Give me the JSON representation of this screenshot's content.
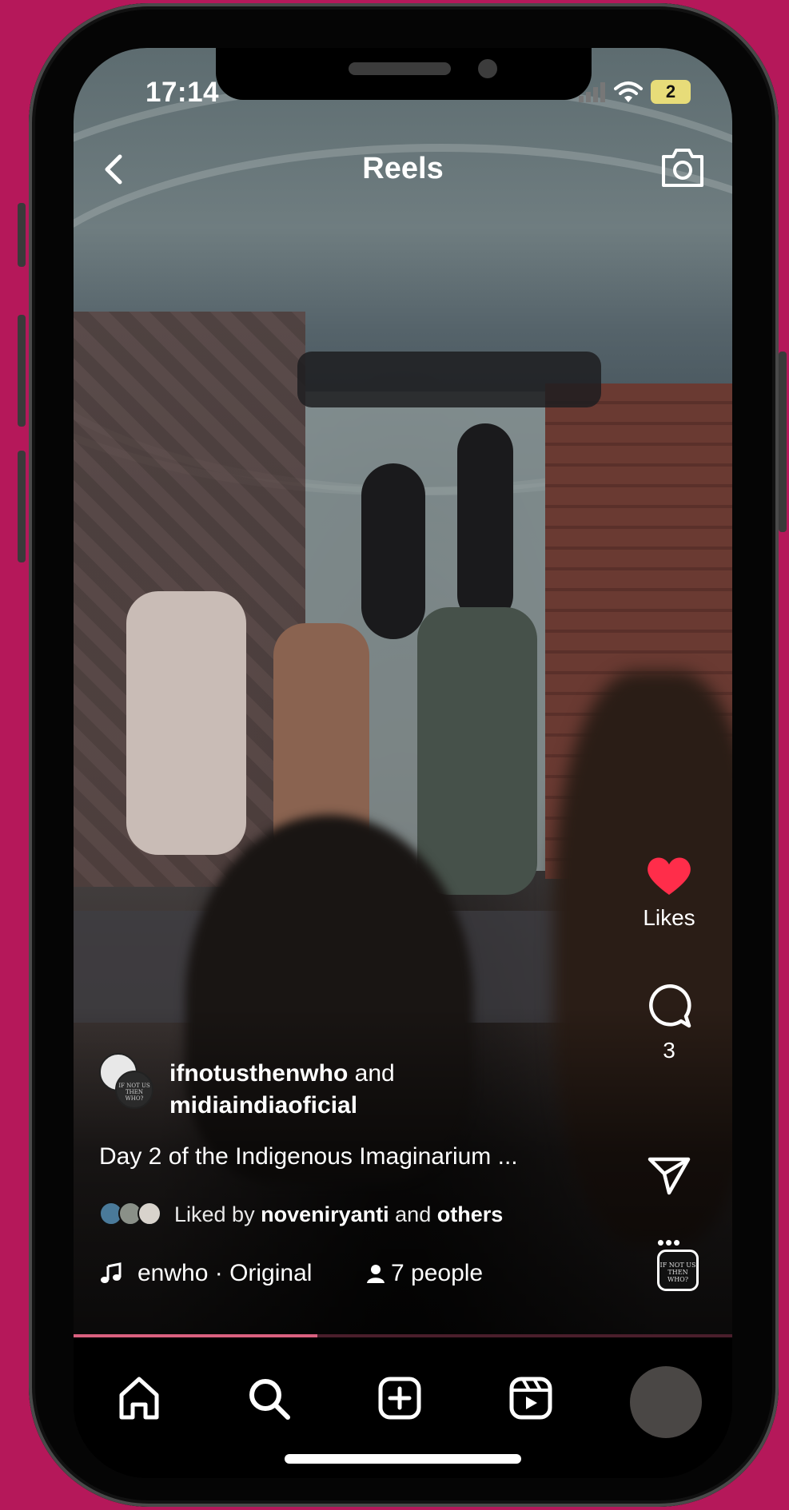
{
  "status_bar": {
    "time": "17:14",
    "battery_level": "2"
  },
  "header": {
    "title": "Reels"
  },
  "post": {
    "author_primary": "ifnotusthenwho",
    "author_joiner": "and",
    "author_secondary": "midiaindiaoficial",
    "caption": "Day 2 of the Indigenous Imaginarium ...",
    "liked_prefix": "Liked by",
    "liked_user": "noveniryanti",
    "liked_joiner": "and",
    "liked_suffix": "others",
    "audio_text": "enwho · Original",
    "people_count": "7 people",
    "avatar_thumb_text": "IF NOT US THEN WHO?"
  },
  "actions": {
    "likes_label": "Likes",
    "comments_count": "3",
    "more_label": "•••"
  },
  "playback": {
    "progress": 0.37
  },
  "colors": {
    "background": "#b5185a",
    "like_heart": "#ff2d4a",
    "progress": "#d9607f"
  },
  "icons": [
    "back-icon",
    "camera-icon",
    "heart-icon",
    "comment-icon",
    "share-icon",
    "more-icon",
    "music-note-icon",
    "person-icon",
    "home-icon",
    "search-icon",
    "create-icon",
    "reels-icon"
  ]
}
